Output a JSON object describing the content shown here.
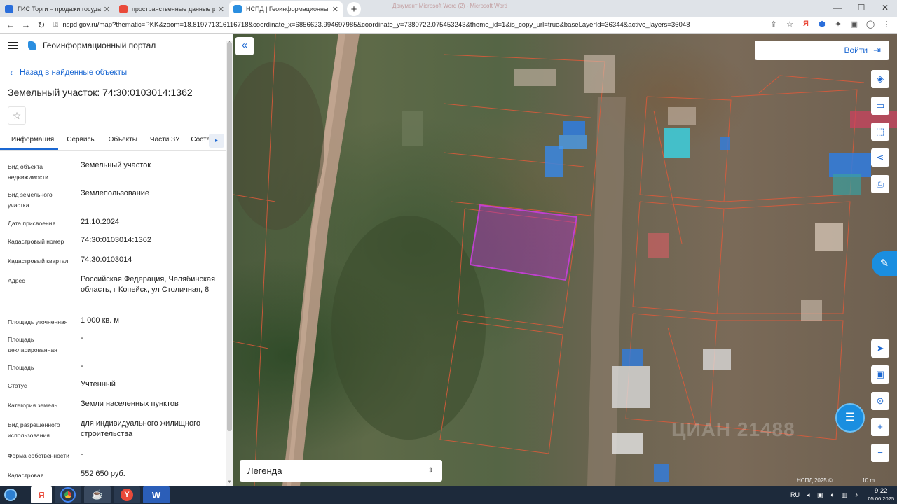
{
  "browser": {
    "tabs": [
      {
        "title": "ГИС Торги – продажи государств",
        "color": "#2a6edb"
      },
      {
        "title": "пространственные данные рос",
        "color": "#e94a3a"
      },
      {
        "title": "НСПД | Геоинформационный п",
        "color": "#2a8ee0"
      }
    ],
    "background_window_title": "Документ Microsoft Word (2) - Microsoft Word",
    "url": "nspd.gov.ru/map?thematic=PKK&zoom=18.819771316116718&coordinate_x=6856623.994697985&coordinate_y=7380722.075453243&theme_id=1&is_copy_url=true&baseLayerId=36344&active_layers=36048"
  },
  "panel": {
    "portal_title": "Геоинформационный портал",
    "back_label": "Назад в найденные объекты",
    "object_title": "Земельный участок: 74:30:0103014:1362",
    "tabs": [
      "Информация",
      "Сервисы",
      "Объекты",
      "Части ЗУ",
      "Соста"
    ],
    "rows": [
      {
        "label": "Вид объекта недвижимости",
        "value": "Земельный участок"
      },
      {
        "label": "Вид земельного участка",
        "value": "Землепользование"
      },
      {
        "label": "Дата присвоения",
        "value": "21.10.2024"
      },
      {
        "label": "Кадастровый номер",
        "value": "74:30:0103014:1362"
      },
      {
        "label": "Кадастровый квартал",
        "value": "74:30:0103014"
      },
      {
        "label": "Адрес",
        "value": "Российская Федерация, Челябинская область, г Копейск, ул Столичная, 8"
      },
      {
        "label": "Площадь уточненная",
        "value": "1 000 кв. м"
      },
      {
        "label": "Площадь декларированная",
        "value": "-"
      },
      {
        "label": "Площадь",
        "value": "-"
      },
      {
        "label": "Статус",
        "value": "Учтенный"
      },
      {
        "label": "Категория земель",
        "value": "Земли населенных пунктов"
      },
      {
        "label": "Вид разрешенного использования",
        "value": "для индивидуального жилищного строительства"
      },
      {
        "label": "Форма собственности",
        "value": "-"
      },
      {
        "label": "Кадастровая",
        "value": "552 650 руб."
      }
    ]
  },
  "map": {
    "login_label": "Войти",
    "legend_label": "Легенда",
    "copyright": "НСПД 2025 ©",
    "scale_label": "10 m",
    "watermark": "ЦИАН 21488"
  },
  "taskbar": {
    "lang": "RU",
    "time": "9:22",
    "date": "05.06.2025"
  },
  "colors": {
    "accent": "#1a67d2",
    "selected_parcel": "#b030c0",
    "parcel_border": "#e05a3a"
  }
}
